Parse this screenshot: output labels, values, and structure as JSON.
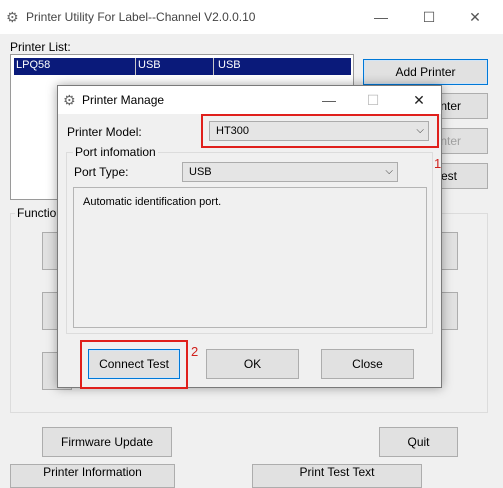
{
  "main_window": {
    "title": "Printer Utility For Label--Channel  V2.0.0.10",
    "controls": {
      "minimize": "—",
      "maximize": "☐",
      "close": "✕"
    },
    "printer_list_label": "Printer List:",
    "printer_rows": [
      {
        "name": "LPQ58",
        "port": "USB",
        "port2": "USB"
      }
    ],
    "side_buttons": {
      "add_printer": "Add Printer",
      "partial_1": "nter",
      "partial_2": "nter",
      "partial_3": "est"
    },
    "function_group_label": "Function",
    "firmware_update": "Firmware Update",
    "quit": "Quit",
    "printer_information": "Printer Information",
    "print_test_text": "Print Test Text"
  },
  "dialog": {
    "title": "Printer Manage",
    "controls": {
      "minimize": "—",
      "maximize": "☐",
      "close": "✕"
    },
    "printer_model_label": "Printer Model:",
    "printer_model_value": "HT300",
    "port_group_label": "Port infomation",
    "port_type_label": "Port Type:",
    "port_type_value": "USB",
    "info_text": "Automatic identification port.",
    "buttons": {
      "connect_test": "Connect Test",
      "ok": "OK",
      "close": "Close"
    }
  },
  "annotations": {
    "marker_1": "1",
    "marker_2": "2",
    "highlight_color": "#e0201c"
  },
  "icons": {
    "app_icon": "gear-icon",
    "dialog_icon": "gear-icon",
    "dropdown": "chevron-down-icon"
  }
}
